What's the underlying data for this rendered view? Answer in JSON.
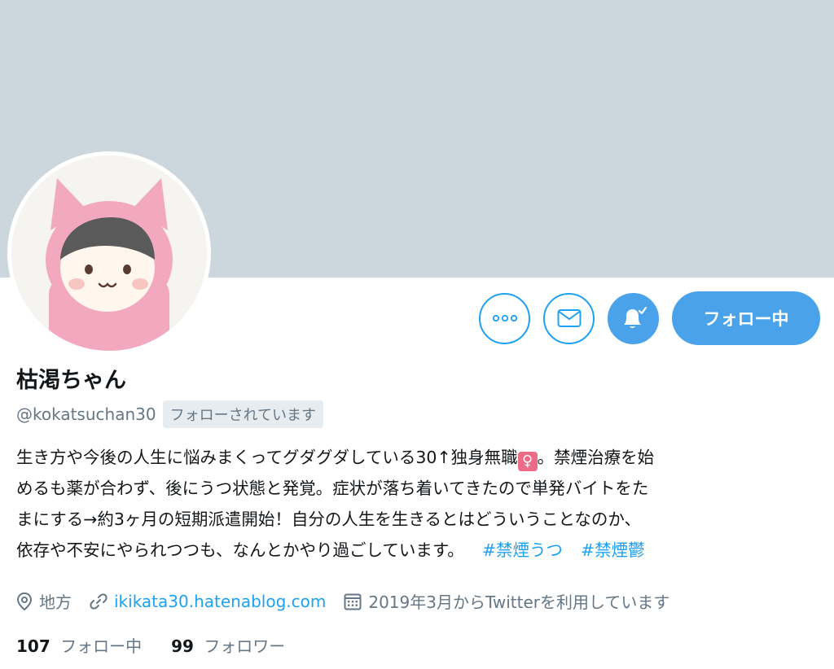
{
  "profile": {
    "name": "枯渇ちゃん",
    "handle": "@kokatsuchan30",
    "follows_you": "フォローされています",
    "bio_lines": [
      "生き方や今後の人生に悩みまくってグダグダしている30↑独身無職",
      "。禁煙治療を始",
      "めるも薬が合わず、後にうつ状態と発覚。症状が落ち着いてきたので単発バイトをた",
      "まにする→約3ヶ月の短期派遣開始！自分の人生を生きるとはどういうことなのか、",
      "依存や不安にやられつつも、なんとかやり過ごしています。"
    ],
    "venus_emoji": "♀",
    "hashtags": [
      "#禁煙うつ",
      "#禁煙鬱"
    ],
    "location": "地方",
    "website": "ikikata30.hatenablog.com",
    "joined": "2019年3月からTwitterを利用しています"
  },
  "counts": {
    "following_num": "107",
    "following_label": "フォロー中",
    "followers_num": "99",
    "followers_label": "フォロワー"
  },
  "actions": {
    "more_icon": "more-icon",
    "message_icon": "mail-icon",
    "notify_icon": "bell-check-icon",
    "follow_label": "フォロー中"
  },
  "colors": {
    "banner": "#ccd6dd",
    "accent": "#1da1f2",
    "button_fill": "#4aa3ea",
    "secondary_text": "#657786"
  }
}
